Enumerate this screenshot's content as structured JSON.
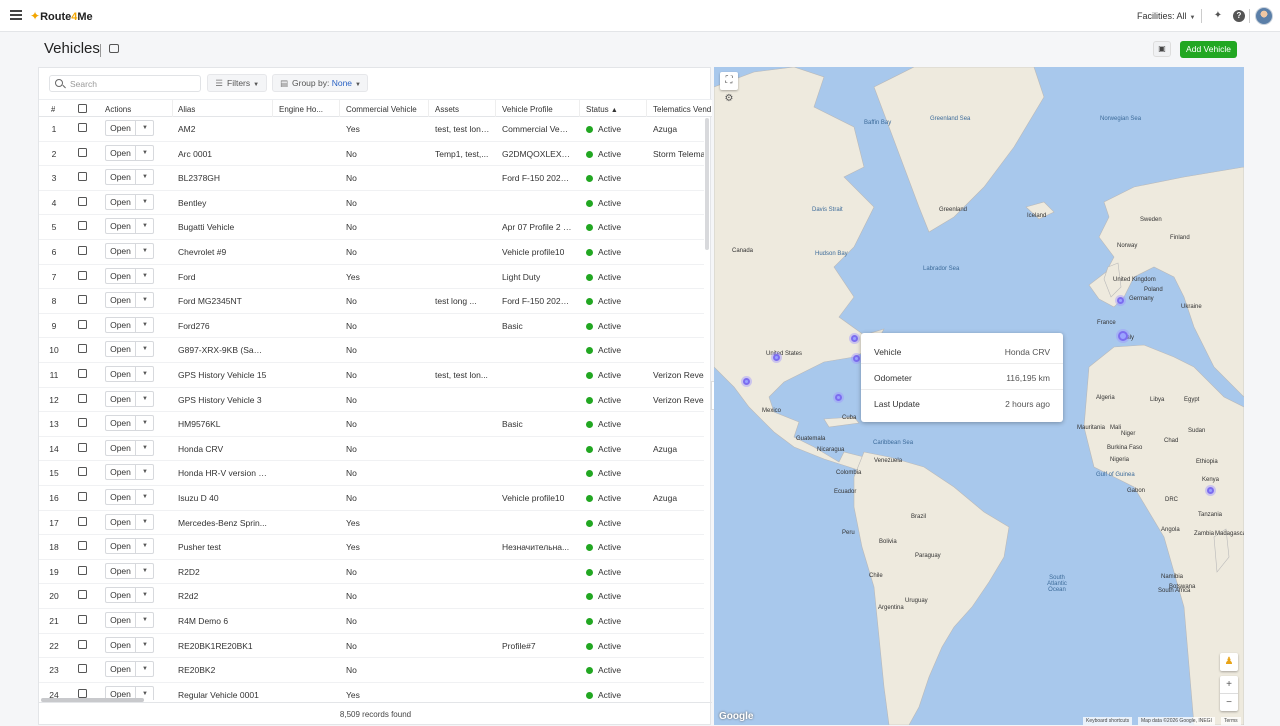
{
  "app": {
    "brand_route": "Route",
    "brand_4": "4",
    "brand_me": "Me"
  },
  "header": {
    "facilities_label": "Facilities:",
    "facilities_value": "All"
  },
  "page": {
    "title": "Vehicles",
    "add_button": "Add Vehicle"
  },
  "toolbar": {
    "search_placeholder": "Search",
    "filters_label": "Filters",
    "group_by_label": "Group by:",
    "group_by_value": "None"
  },
  "table": {
    "columns": [
      "#",
      "Actions",
      "Alias",
      "Engine Ho...",
      "Commercial Vehicle",
      "Assets",
      "Vehicle Profile",
      "Status",
      "Telematics Vend..."
    ],
    "open_label": "Open",
    "rows": [
      {
        "n": "1",
        "alias": "AM2",
        "commercial": "Yes",
        "assets": "test, test long ...",
        "profile": "Commercial Vehi...",
        "status": "Active",
        "telematics": "Azuga"
      },
      {
        "n": "2",
        "alias": "Arc 0001",
        "commercial": "No",
        "assets": "Temp1, test,...",
        "profile": "G2DMQOXLEXFY...",
        "status": "Active",
        "telematics": "Storm Telemat..."
      },
      {
        "n": "3",
        "alias": "BL2378GH",
        "commercial": "No",
        "assets": "",
        "profile": "Ford F-150 2023 ...",
        "status": "Active",
        "telematics": ""
      },
      {
        "n": "4",
        "alias": "Bentley",
        "commercial": "No",
        "assets": "",
        "profile": "",
        "status": "Active",
        "telematics": ""
      },
      {
        "n": "5",
        "alias": "Bugatti Vehicle",
        "commercial": "No",
        "assets": "",
        "profile": "Apr 07 Profile 2 E...",
        "status": "Active",
        "telematics": ""
      },
      {
        "n": "6",
        "alias": "Chevrolet #9",
        "commercial": "No",
        "assets": "",
        "profile": "Vehicle profile10",
        "status": "Active",
        "telematics": ""
      },
      {
        "n": "7",
        "alias": "Ford",
        "commercial": "Yes",
        "assets": "",
        "profile": "Light Duty",
        "status": "Active",
        "telematics": ""
      },
      {
        "n": "8",
        "alias": "Ford MG2345NT",
        "commercial": "No",
        "assets": "test long ...",
        "profile": "Ford F-150 2023 ...",
        "status": "Active",
        "telematics": ""
      },
      {
        "n": "9",
        "alias": "Ford276",
        "commercial": "No",
        "assets": "",
        "profile": "Basic",
        "status": "Active",
        "telematics": ""
      },
      {
        "n": "10",
        "alias": "G897-XRX-9KB (Sams...",
        "commercial": "No",
        "assets": "",
        "profile": "",
        "status": "Active",
        "telematics": ""
      },
      {
        "n": "11",
        "alias": "GPS History Vehicle 15",
        "commercial": "No",
        "assets": "test, test lon...",
        "profile": "",
        "status": "Active",
        "telematics": "Verizon Reveal"
      },
      {
        "n": "12",
        "alias": "GPS History Vehicle 3",
        "commercial": "No",
        "assets": "",
        "profile": "",
        "status": "Active",
        "telematics": "Verizon Reveal"
      },
      {
        "n": "13",
        "alias": "HM9576KL",
        "commercial": "No",
        "assets": "",
        "profile": "Basic",
        "status": "Active",
        "telematics": ""
      },
      {
        "n": "14",
        "alias": "Honda CRV",
        "commercial": "No",
        "assets": "",
        "profile": "",
        "status": "Active",
        "telematics": "Azuga"
      },
      {
        "n": "15",
        "alias": "Honda HR-V version 2...",
        "commercial": "No",
        "assets": "",
        "profile": "",
        "status": "Active",
        "telematics": ""
      },
      {
        "n": "16",
        "alias": "Isuzu D 40",
        "commercial": "No",
        "assets": "",
        "profile": "Vehicle profile10",
        "status": "Active",
        "telematics": "Azuga"
      },
      {
        "n": "17",
        "alias": "Mercedes-Benz Sprin...",
        "commercial": "Yes",
        "assets": "",
        "profile": "",
        "status": "Active",
        "telematics": ""
      },
      {
        "n": "18",
        "alias": "Pusher test",
        "commercial": "Yes",
        "assets": "",
        "profile": "Незначительна...",
        "status": "Active",
        "telematics": ""
      },
      {
        "n": "19",
        "alias": "R2D2",
        "commercial": "No",
        "assets": "",
        "profile": "",
        "status": "Active",
        "telematics": ""
      },
      {
        "n": "20",
        "alias": "R2d2",
        "commercial": "No",
        "assets": "",
        "profile": "",
        "status": "Active",
        "telematics": ""
      },
      {
        "n": "21",
        "alias": "R4M Demo 6",
        "commercial": "No",
        "assets": "",
        "profile": "",
        "status": "Active",
        "telematics": ""
      },
      {
        "n": "22",
        "alias": "RE20BK1RE20BK1",
        "commercial": "No",
        "assets": "",
        "profile": "Profile#7",
        "status": "Active",
        "telematics": ""
      },
      {
        "n": "23",
        "alias": "RE20BK2",
        "commercial": "No",
        "assets": "",
        "profile": "",
        "status": "Active",
        "telematics": ""
      },
      {
        "n": "24",
        "alias": "Regular Vehicle 0001",
        "commercial": "Yes",
        "assets": "",
        "profile": "",
        "status": "Active",
        "telematics": ""
      }
    ],
    "footer_count": "8,509",
    "footer_text": "records found"
  },
  "map": {
    "popup": {
      "vehicle_label": "Vehicle",
      "vehicle_value": "Honda CRV",
      "odometer_label": "Odometer",
      "odometer_value": "116,195 km",
      "update_label": "Last Update",
      "update_value": "2 hours ago"
    },
    "labels": [
      {
        "t": "Baffin Bay",
        "c": "sea"
      },
      {
        "t": "Greenland Sea",
        "c": "sea"
      },
      {
        "t": "Norwegian Sea",
        "c": "sea"
      },
      {
        "t": "Davis Strait",
        "c": "sea"
      },
      {
        "t": "Greenland",
        "c": "land"
      },
      {
        "t": "Iceland",
        "c": "land"
      },
      {
        "t": "Sweden",
        "c": "land"
      },
      {
        "t": "Finland",
        "c": "land"
      },
      {
        "t": "Norway",
        "c": "land"
      },
      {
        "t": "Canada",
        "c": "land"
      },
      {
        "t": "Hudson Bay",
        "c": "sea"
      },
      {
        "t": "Labrador Sea",
        "c": "sea"
      },
      {
        "t": "United Kingdom",
        "c": "land"
      },
      {
        "t": "Poland",
        "c": "land"
      },
      {
        "t": "Germany",
        "c": "land"
      },
      {
        "t": "Ukraine",
        "c": "land"
      },
      {
        "t": "France",
        "c": "land"
      },
      {
        "t": "Italy",
        "c": "land"
      },
      {
        "t": "United States",
        "c": "land"
      },
      {
        "t": "Mexico",
        "c": "land"
      },
      {
        "t": "Cuba",
        "c": "land"
      },
      {
        "t": "Guatemala",
        "c": "land"
      },
      {
        "t": "Nicaragua",
        "c": "land"
      },
      {
        "t": "Caribbean Sea",
        "c": "sea"
      },
      {
        "t": "Venezuela",
        "c": "land"
      },
      {
        "t": "Colombia",
        "c": "land"
      },
      {
        "t": "Algeria",
        "c": "land"
      },
      {
        "t": "Libya",
        "c": "land"
      },
      {
        "t": "Egypt",
        "c": "land"
      },
      {
        "t": "Mauritania",
        "c": "land"
      },
      {
        "t": "Mali",
        "c": "land"
      },
      {
        "t": "Niger",
        "c": "land"
      },
      {
        "t": "Chad",
        "c": "land"
      },
      {
        "t": "Sudan",
        "c": "land"
      },
      {
        "t": "Burkina Faso",
        "c": "land"
      },
      {
        "t": "Nigeria",
        "c": "land"
      },
      {
        "t": "Ethiopia",
        "c": "land"
      },
      {
        "t": "Gulf of Guinea",
        "c": "sea"
      },
      {
        "t": "Kenya",
        "c": "land"
      },
      {
        "t": "Gabon",
        "c": "land"
      },
      {
        "t": "DRC",
        "c": "land"
      },
      {
        "t": "Tanzania",
        "c": "land"
      },
      {
        "t": "Ecuador",
        "c": "land"
      },
      {
        "t": "Peru",
        "c": "land"
      },
      {
        "t": "Brazil",
        "c": "land"
      },
      {
        "t": "Bolivia",
        "c": "land"
      },
      {
        "t": "Angola",
        "c": "land"
      },
      {
        "t": "Zambia",
        "c": "land"
      },
      {
        "t": "Namibia",
        "c": "land"
      },
      {
        "t": "Botswana",
        "c": "land"
      },
      {
        "t": "Madagascar",
        "c": "land"
      },
      {
        "t": "Chile",
        "c": "land"
      },
      {
        "t": "Paraguay",
        "c": "land"
      },
      {
        "t": "Uruguay",
        "c": "land"
      },
      {
        "t": "Argentina",
        "c": "land"
      },
      {
        "t": "South Atlantic Ocean",
        "c": "sea"
      },
      {
        "t": "South Africa",
        "c": "land"
      }
    ],
    "google": "Google",
    "attr_shortcuts": "Keyboard shortcuts",
    "attr_data": "Map data ©2026 Google, INEGI",
    "attr_terms": "Terms"
  }
}
